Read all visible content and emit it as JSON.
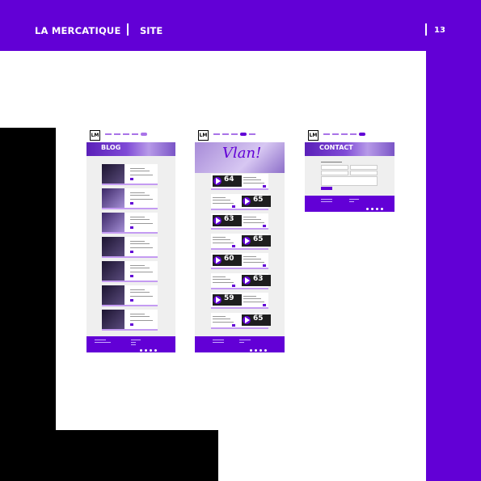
{
  "header": {
    "brand": "LA MERCATIQUE",
    "section": "SITE",
    "page_number": "13"
  },
  "colors": {
    "accent": "#6200d6",
    "black": "#000000",
    "background": "#ffffff"
  },
  "mockups": {
    "logo": "LM",
    "blog": {
      "hero_title": "BLOG"
    },
    "vlan": {
      "hero_title": "Vlan!",
      "video_numbers": [
        "64",
        "65",
        "63",
        "65",
        "60",
        "63",
        "59",
        "65"
      ]
    },
    "contact": {
      "hero_title": "CONTACT"
    }
  }
}
